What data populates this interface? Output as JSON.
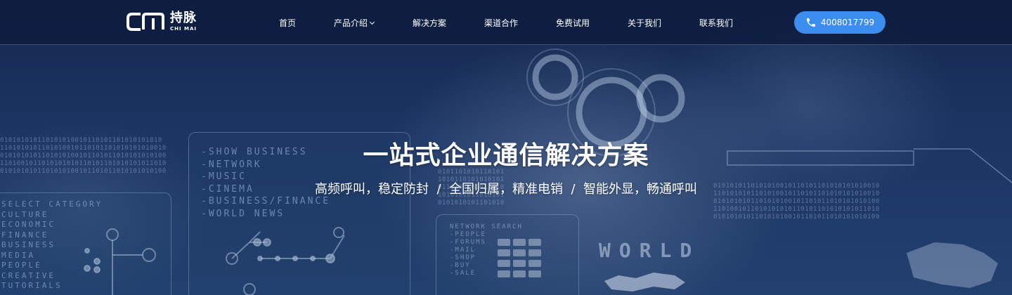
{
  "brand": {
    "logo_mark": "CM",
    "name_cn": "持脉",
    "name_en": "CHI MAI"
  },
  "nav": {
    "items": [
      {
        "label": "首页"
      },
      {
        "label": "产品介绍"
      },
      {
        "label": "解决方案"
      },
      {
        "label": "渠道合作"
      },
      {
        "label": "免费试用"
      },
      {
        "label": "关于我们"
      },
      {
        "label": "联系我们"
      }
    ],
    "dropdown_icon": "chevron-down-icon"
  },
  "contact": {
    "icon": "phone-icon",
    "phone": "4008017799",
    "button_color": "#3b8df0"
  },
  "hero": {
    "title": "一站式企业通信解决方案",
    "subtitle": "高频呼叫，稳定防封  /  全国归属，精准电销  /  智能外显，畅通呼叫"
  },
  "background_text": {
    "media_list": "-SHOW BUSINESS\n-NETWORK\n-MUSIC\n-CINEMA\n-BUSINESS/FINANCE\n-WORLD NEWS",
    "category_list": "SELECT CATEGORY\nCULTURE\nECONOMIC\nFINANCE\nBUSINESS\nMEDIA\nPEOPLE\nCREATIVE\nTUTORIALS",
    "network_search": "NETWORK SEARCH\n-PEOPLE\n-FORUMS\n-MAIL\n-SHOP\n-BUY\n-SALE",
    "world": "WORLD"
  },
  "colors": {
    "header_bg": "#0c1c3e",
    "hero_bg": "#1c3563",
    "accent": "#3b8df0"
  }
}
